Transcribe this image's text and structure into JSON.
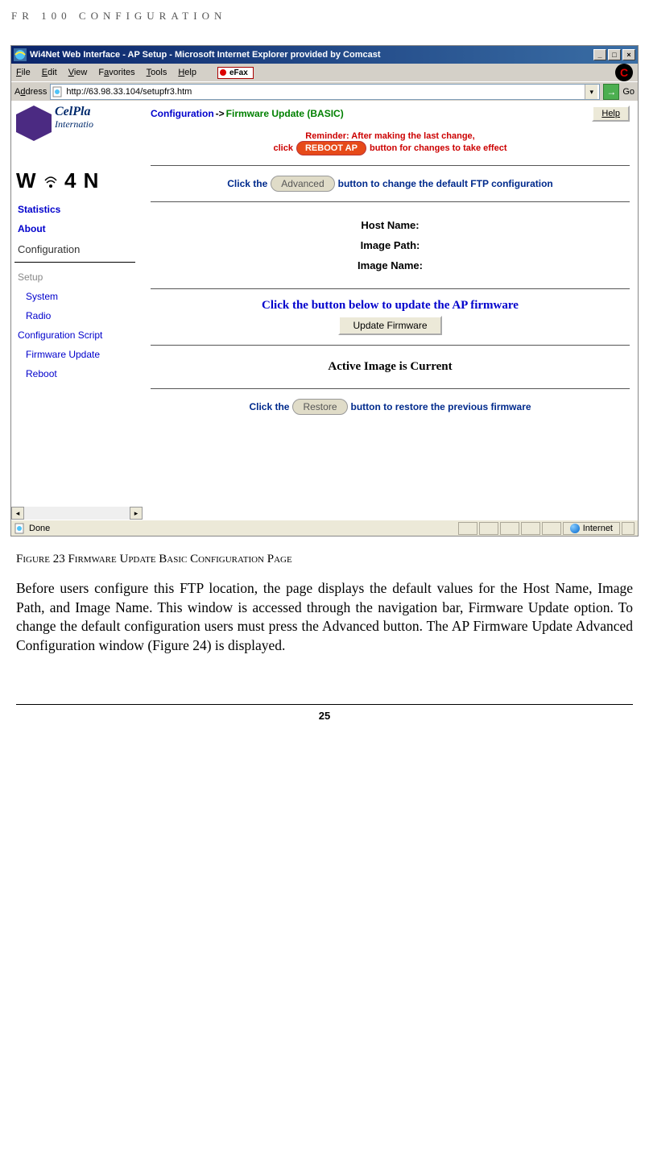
{
  "doc": {
    "header": "FR 100 CONFIGURATION",
    "figure_caption": "Figure 23 Firmware Update  Basic Configuration Page",
    "body": "Before users configure this FTP location, the page displays the default values for the Host Name, Image Path, and Image Name. This window is accessed through the navigation bar, Firmware Update option. To change the default configuration users must press the Advanced button. The AP Firmware Update Advanced Configuration window (Figure 24) is displayed.",
    "page_number": "25"
  },
  "window": {
    "title": "Wi4Net Web Interface - AP Setup - Microsoft Internet Explorer provided by Comcast",
    "minimize": "_",
    "maximize": "□",
    "close": "×",
    "menu": [
      "File",
      "Edit",
      "View",
      "Favorites",
      "Tools",
      "Help"
    ],
    "efax": "eFax",
    "c_logo": "C",
    "address_label": "Address",
    "address_url": "http://63.98.33.104/setupfr3.htm",
    "go": "Go",
    "status_done": "Done",
    "status_zone": "Internet"
  },
  "page": {
    "brand_top": "CelPla",
    "brand_sub": "Internatio",
    "brand_logo_text": "W i 4 N",
    "crumb_config": "Configuration",
    "crumb_arrow": " -> ",
    "crumb_current": "Firmware Update (BASIC)",
    "help": "Help",
    "reminder1": "Reminder: After making the last change,",
    "reminder2a": "click",
    "reboot_btn": "REBOOT AP",
    "reminder2b": "button for changes to take effect",
    "adv_prefix": "Click the",
    "adv_btn": "Advanced",
    "adv_suffix": "button to change the default FTP configuration",
    "fields": {
      "host": "Host Name:",
      "path": "Image Path:",
      "name": "Image Name:"
    },
    "update_heading": "Click the button below to update the AP firmware",
    "update_btn": "Update Firmware",
    "active_image": "Active Image is Current",
    "restore_prefix": "Click the",
    "restore_btn": "Restore",
    "restore_suffix": "button to restore the previous firmware"
  },
  "sidebar": {
    "statistics": "Statistics",
    "about": "About",
    "configuration": "Configuration",
    "setup": "Setup",
    "system": "System",
    "radio": "Radio",
    "cfgscript": "Configuration Script",
    "firmware": "Firmware Update",
    "reboot": "Reboot"
  }
}
